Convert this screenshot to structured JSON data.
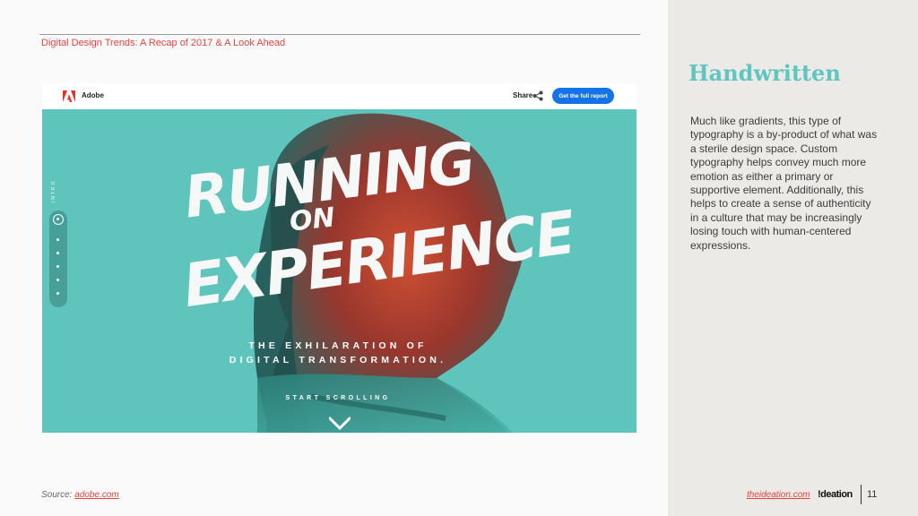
{
  "slide": {
    "header": "Digital Design Trends: A Recap of 2017 & A Look Ahead",
    "title": "Handwritten",
    "body": "Much like gradients, this type of typography is a by-product of what was a sterile design space. Custom typography helps convey much more emotion as either a primary or supportive element. Additionally, this helps to create a sense of authenticity in a culture that may be increasingly losing touch with human-centered expressions.",
    "source_label": "Source: ",
    "source_link": "adobe.com",
    "footer_link": "theideation.com",
    "footer_logo": "!deation",
    "page_number": "11"
  },
  "screenshot": {
    "brand": "Adobe",
    "share_label": "Share",
    "cta_label": "Get the full report",
    "side_nav_label": "INTRO",
    "headline": {
      "line1": "RUNNING",
      "line2": "ON",
      "line3": "EXPERIENCE"
    },
    "tagline_1": "THE EXHILARATION OF",
    "tagline_2": "DIGITAL TRANSFORMATION.",
    "scroll_label": "START SCROLLING"
  },
  "colors": {
    "accent_red": "#e8423f",
    "title_teal": "#5ec5c0",
    "hero_teal": "#5fc4bc",
    "cta_blue": "#1473e6"
  },
  "icons": [
    "adobe-logo-icon",
    "share-icon",
    "nav-dot-icon",
    "chevron-down-icon"
  ]
}
